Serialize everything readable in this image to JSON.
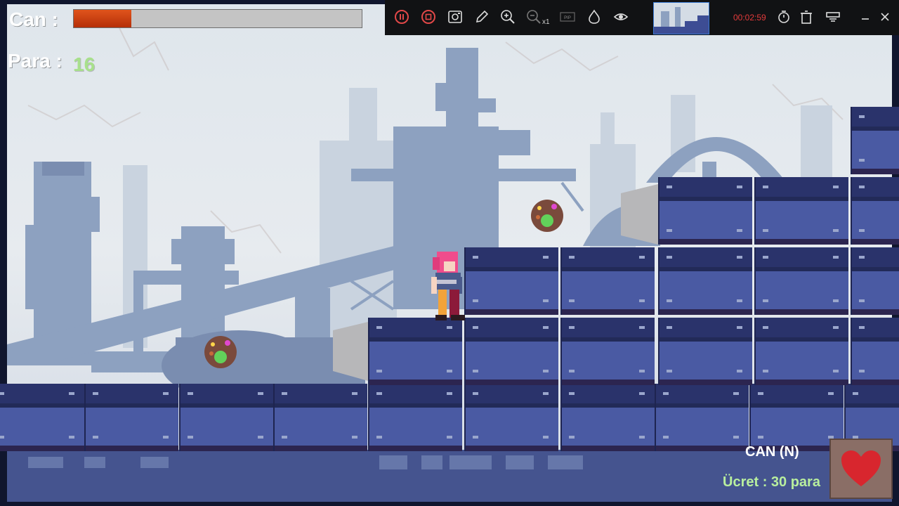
{
  "hud": {
    "health_label": "Can :",
    "health_level": 0.2,
    "money_label": "Para :",
    "money_value": "16"
  },
  "recorder": {
    "zoom_level": "x1",
    "pip_label": "PIP",
    "elapsed_time": "00:02:59",
    "icons": [
      "pause-icon",
      "stop-icon",
      "screenshot-icon",
      "pencil-icon",
      "zoom-in-icon",
      "zoom-out-icon",
      "pip-icon",
      "drop-icon",
      "eye-icon",
      "timer-icon",
      "trash-icon",
      "settings-icon",
      "minimize-icon",
      "close-icon"
    ]
  },
  "shop": {
    "item_title": "CAN (N)",
    "price_text": "Ücret : 30 para",
    "item_icon": "heart-icon"
  },
  "colors": {
    "health_fill": "#c73d12",
    "money_value": "#a8e08c",
    "price_text": "#b9ef9e",
    "block_fill": "#3d4d94",
    "block_top": "#2a336b",
    "record_time": "#e33b3b"
  }
}
